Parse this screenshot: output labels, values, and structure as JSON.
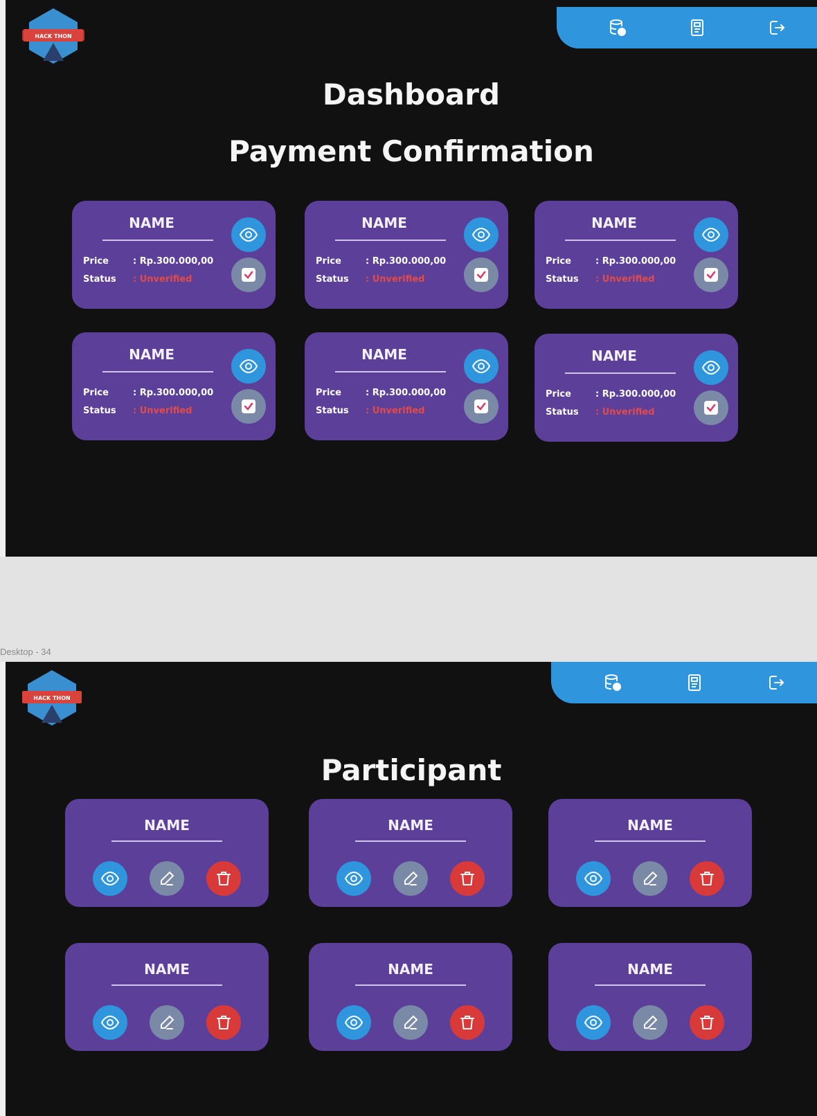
{
  "frame_label": "Desktop - 34",
  "logo": {
    "text": "HACK THON"
  },
  "navbar": {
    "items": [
      {
        "name": "database-icon"
      },
      {
        "name": "document-icon"
      },
      {
        "name": "logout-icon"
      }
    ]
  },
  "dashboard": {
    "title": "Dashboard",
    "subtitle": "Payment Confirmation",
    "price_label": "Price",
    "status_label": "Status",
    "cards": [
      {
        "name": "NAME",
        "price": ": Rp.300.000,00",
        "status": ": Unverified"
      },
      {
        "name": "NAME",
        "price": ": Rp.300.000,00",
        "status": ": Unverified"
      },
      {
        "name": "NAME",
        "price": ": Rp.300.000,00",
        "status": ": Unverified"
      },
      {
        "name": "NAME",
        "price": ": Rp.300.000,00",
        "status": ": Unverified"
      },
      {
        "name": "NAME",
        "price": ": Rp.300.000,00",
        "status": ": Unverified"
      },
      {
        "name": "NAME",
        "price": ": Rp.300.000,00",
        "status": ": Unverified"
      }
    ]
  },
  "participant": {
    "title": "Participant",
    "cards": [
      {
        "name": "NAME"
      },
      {
        "name": "NAME"
      },
      {
        "name": "NAME"
      },
      {
        "name": "NAME"
      },
      {
        "name": "NAME"
      },
      {
        "name": "NAME"
      }
    ]
  },
  "colors": {
    "background": "#111111",
    "card": "#5b3f99",
    "accent_blue": "#2f95dc",
    "grey_button": "#7a8aa6",
    "danger": "#d83a3a",
    "unverified": "#e04b4b"
  }
}
